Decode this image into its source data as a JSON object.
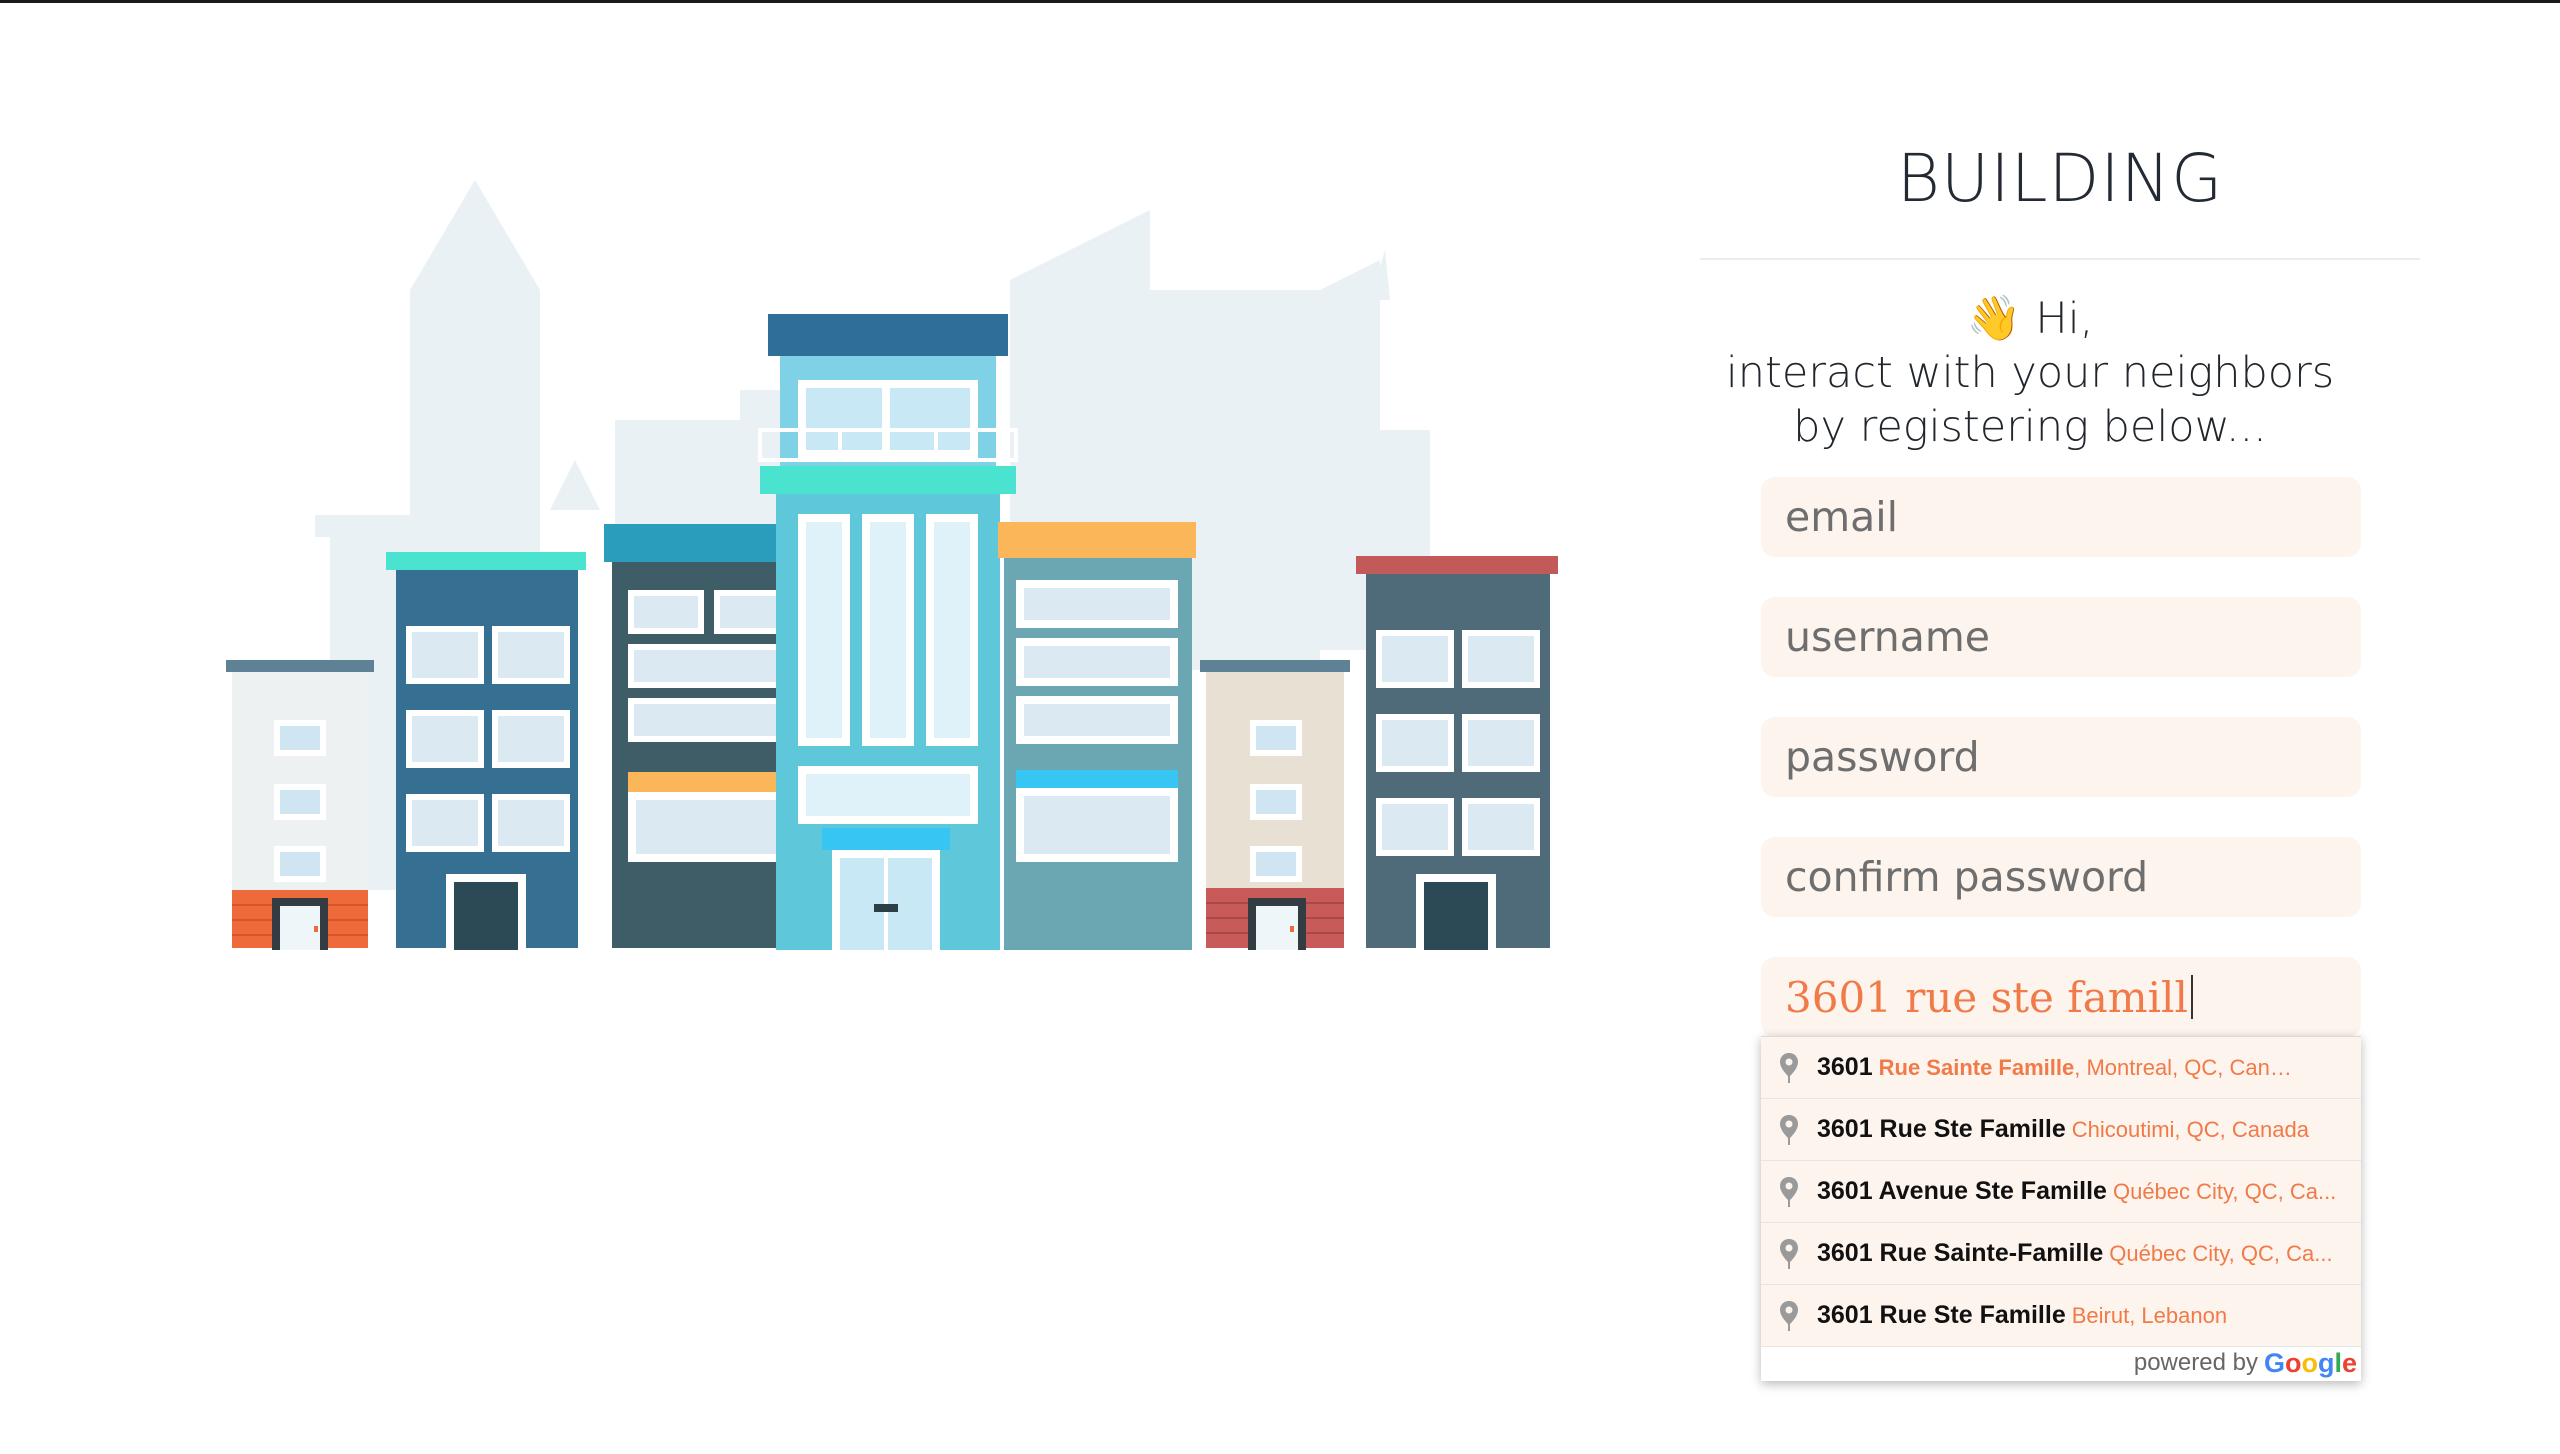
{
  "brand": {
    "title": "BUILDING"
  },
  "greeting": {
    "line1": "Hi,",
    "line2": "interact with your neighbors",
    "line3": "by registering below..."
  },
  "form": {
    "email_placeholder": "email",
    "username_placeholder": "username",
    "password_placeholder": "password",
    "confirm_placeholder": "confirm password",
    "address_value": "3601 rue ste famill"
  },
  "autocomplete": {
    "suggestions": [
      {
        "main": "3601",
        "match": "Rue Sainte Famille",
        "secondary": ", Montreal, QC, Canada"
      },
      {
        "main": "3601 Rue Ste Famille",
        "secondary": "Chicoutimi, QC, Canada"
      },
      {
        "main": "3601 Avenue Ste Famille",
        "secondary": "Québec City, QC, Ca..."
      },
      {
        "main": "3601 Rue Sainte-Famille",
        "secondary": "Québec City, QC, Ca..."
      },
      {
        "main": "3601 Rue Ste Famille",
        "secondary": "Beirut, Lebanon"
      }
    ],
    "powered_by": "powered by",
    "provider": [
      "G",
      "o",
      "o",
      "g",
      "l",
      "e"
    ]
  },
  "colors": {
    "accent": "#f07a48",
    "field_bg": "#fdf4ee",
    "google": [
      "#4285F4",
      "#EA4335",
      "#FBBC05",
      "#4285F4",
      "#34A853",
      "#EA4335"
    ]
  },
  "icons": {
    "greeting": "waving-hand-icon",
    "suggestion": "map-pin-icon"
  }
}
